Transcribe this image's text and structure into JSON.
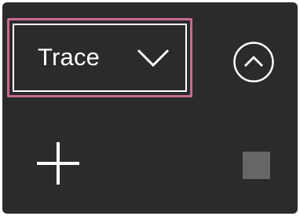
{
  "trace_select": {
    "selected_label": "Trace",
    "highlight_color": "#c96a92"
  },
  "icons": {
    "dropdown": "chevron-down-icon",
    "collapse": "chevron-up-circle-icon",
    "add": "plus-icon",
    "stop": "stop-square-icon"
  },
  "colors": {
    "panel_background": "#2b2b2b",
    "foreground": "#ffffff",
    "stop_button": "#666666"
  }
}
